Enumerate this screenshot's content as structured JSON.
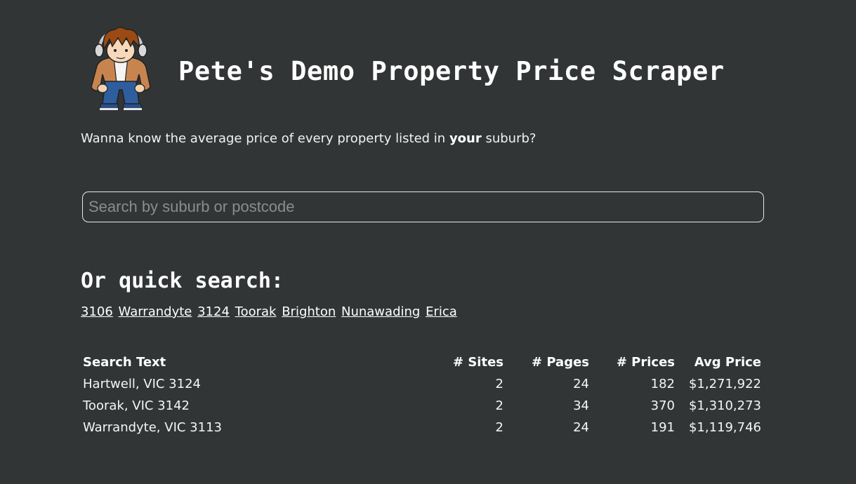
{
  "header": {
    "title": "Pete's Demo Property Price Scraper"
  },
  "intro": {
    "before": "Wanna know the average price of every property listed in ",
    "bold": "your",
    "after": " suburb?"
  },
  "search": {
    "placeholder": "Search by suburb or postcode",
    "value": ""
  },
  "quick_search": {
    "heading": "Or quick search:",
    "links": [
      "3106",
      "Warrandyte",
      "3124",
      "Toorak",
      "Brighton",
      "Nunawading",
      "Erica"
    ]
  },
  "results": {
    "headers": [
      "Search Text",
      "# Sites",
      "# Pages",
      "# Prices",
      "Avg Price"
    ],
    "rows": [
      [
        "Hartwell, VIC 3124",
        "2",
        "24",
        "182",
        "$1,271,922"
      ],
      [
        "Toorak, VIC 3142",
        "2",
        "34",
        "370",
        "$1,310,273"
      ],
      [
        "Warrandyte, VIC 3113",
        "2",
        "24",
        "191",
        "$1,119,746"
      ]
    ]
  },
  "colors": {
    "background": "#323536",
    "text": "#ffffff",
    "input_border": "#e8e8e8"
  }
}
